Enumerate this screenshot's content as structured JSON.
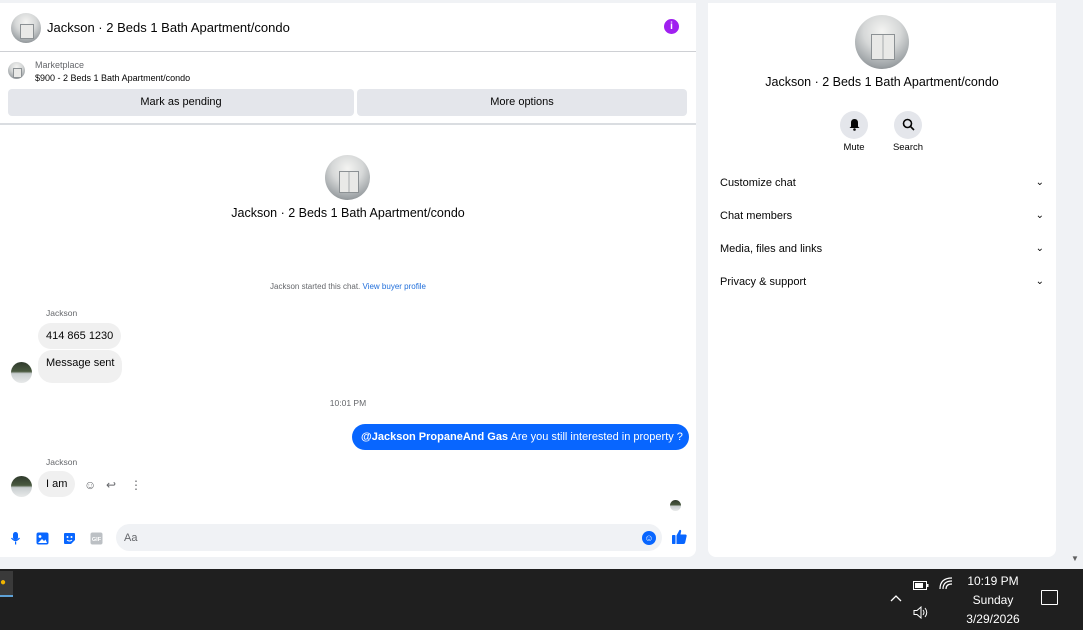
{
  "chat": {
    "title": "Jackson · 2 Beds 1 Bath Apartment/condo",
    "info_icon": "info-icon",
    "marketplace_label": "Marketplace",
    "listing": "$900 - 2 Beds 1 Bath Apartment/condo",
    "mark_pending": "Mark as pending",
    "more_options": "More options",
    "profile_name": "Jackson · 2 Beds 1 Bath Apartment/condo",
    "started_text": "Jackson started this chat. ",
    "buyer_profile_link": "View buyer profile",
    "messages": [
      {
        "sender": "Jackson",
        "text": "414 865 1230"
      },
      {
        "text": "Message sent"
      }
    ],
    "timestamp": "10:01 PM",
    "outgoing_mention": "@Jackson PropaneAnd Gas",
    "outgoing_text": " Are you still interested in property ?",
    "reply": {
      "sender": "Jackson",
      "text": "I am"
    },
    "composer_placeholder": "Aa",
    "accent_color": "#0866ff"
  },
  "side": {
    "title": "Jackson · 2 Beds 1 Bath Apartment/condo",
    "mute_label": "Mute",
    "search_label": "Search",
    "menu": [
      {
        "label": "Customize chat"
      },
      {
        "label": "Chat members"
      },
      {
        "label": "Media, files and links"
      },
      {
        "label": "Privacy & support"
      }
    ]
  },
  "taskbar": {
    "time": "10:19 PM",
    "day": "Sunday",
    "date": "3/29/2026"
  }
}
